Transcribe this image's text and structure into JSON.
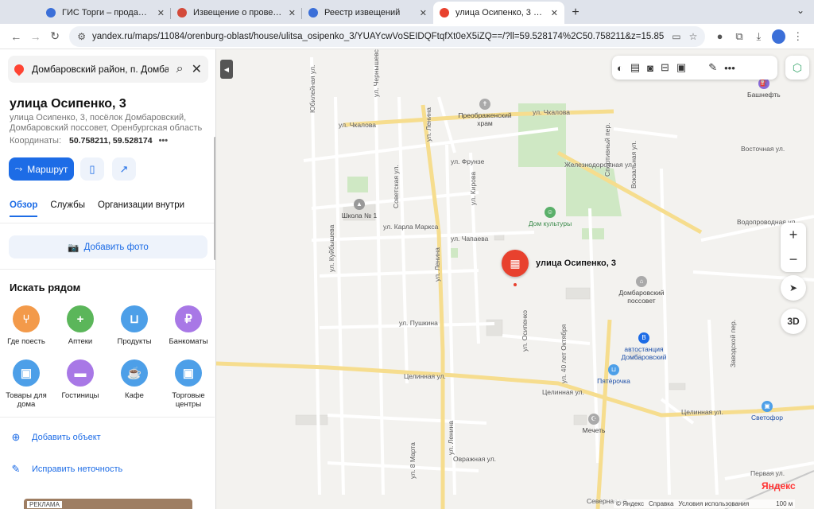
{
  "browser": {
    "tabs": [
      {
        "title": "ГИС Торги – продажи госуд",
        "fav_color": "#3b6fd8"
      },
      {
        "title": "Извещение о проведении то",
        "fav_color": "#d34a3a"
      },
      {
        "title": "Реестр извещений",
        "fav_color": "#3b6fd8"
      },
      {
        "title": "улица Осипенко, 3 — Яндекс",
        "fav_color": "#e8412e"
      }
    ],
    "url": "yandex.ru/maps/11084/orenburg-oblast/house/ulitsa_osipenko_3/YUAYcwVoSEIDQFtqfXt0eX5iZQ==/?ll=59.528174%2C50.758211&z=15.85"
  },
  "panel": {
    "search_value": "Домбаровский район, п. Домбаровский",
    "title": "улица Осипенко, 3",
    "subtitle": "улица Осипенко, 3, посёлок Домбаровский, Домбаровский поссовет, Оренбургская область",
    "coords_label": "Координаты:",
    "coords_value": "50.758211, 59.528174",
    "route_label": "Маршрут",
    "tabs": [
      "Обзор",
      "Службы",
      "Организации внутри"
    ],
    "add_photo": "Добавить фото",
    "nearby_title": "Искать рядом",
    "categories": [
      {
        "label": "Где поесть",
        "icon": "fork-knife-icon",
        "color": "#f39a4a"
      },
      {
        "label": "Аптеки",
        "icon": "pharmacy-icon",
        "color": "#5bb65a"
      },
      {
        "label": "Продукты",
        "icon": "basket-icon",
        "color": "#4d9fe8"
      },
      {
        "label": "Банкоматы",
        "icon": "ruble-icon",
        "color": "#a878e6"
      },
      {
        "label": "Товары для дома",
        "icon": "bag-icon",
        "color": "#4d9fe8"
      },
      {
        "label": "Гостиницы",
        "icon": "bed-icon",
        "color": "#a878e6"
      },
      {
        "label": "Кафе",
        "icon": "cup-icon",
        "color": "#4d9fe8"
      },
      {
        "label": "Торговые центры",
        "icon": "bag-icon",
        "color": "#4d9fe8"
      }
    ],
    "add_object": "Добавить объект",
    "fix_error": "Исправить неточность",
    "ad_label": "РЕКЛАМА"
  },
  "map": {
    "marker_label": "улица Осипенко, 3",
    "streets": {
      "chkalova1": "ул. Чкалова",
      "chkalova2": "ул. Чкалова",
      "lenina1": "ул. Ленина",
      "lenina2": "ул. Ленина",
      "lenina3": "ул. Ленина",
      "frunze": "ул. Фрунзе",
      "kirova": "ул. Кирова",
      "sovetskaya": "Советская ул.",
      "karla_marksa": "ул. Карла Маркса",
      "chapaeva": "ул. Чапаева",
      "pushkina": "ул. Пушкина",
      "celinnaya1": "Целинная ул.",
      "celinnaya2": "Целинная ул.",
      "celinnaya3": "Целинная ул.",
      "vostochnaya": "Восточная ул.",
      "vodoprovodnaya": "Водопроводная ул.",
      "zheleznodorozhnaya": "Железнодорожная ул.",
      "ovrazhnaya": "Овражная ул.",
      "pervaya": "Первая ул.",
      "severnaya": "Северная ул.",
      "osipenko": "ул. Осипенко",
      "yubileynaya": "Юбилейная ул.",
      "kuybysheva": "ул. Куйбышева",
      "chernyshevskogo": "ул. Чернышевского",
      "sportivny": "Спортивный пер.",
      "vokzalnaya": "Вокзальная ул.",
      "zavodskoy": "Заводской пер.",
      "oktyabrya": "ул. 40 лет Октября",
      "marta": "ул. 8 Марта"
    },
    "pois": {
      "bashneft": "Башнефть",
      "khram": "Преображенский храм",
      "shkola": "Школа № 1",
      "dom_kultury": "Дом культуры",
      "possovet": "Домбаровский поссовет",
      "avtostanciya": "автостанция Домбаровский",
      "pyaterochka": "Пятёрочка",
      "mechet": "Мечеть",
      "svetofor": "Светофор"
    },
    "copyright": [
      "© Яндекс",
      "Справка",
      "Условия использования"
    ],
    "scale": "100 м",
    "btn_3d": "3D",
    "logo": "Яндекс"
  }
}
